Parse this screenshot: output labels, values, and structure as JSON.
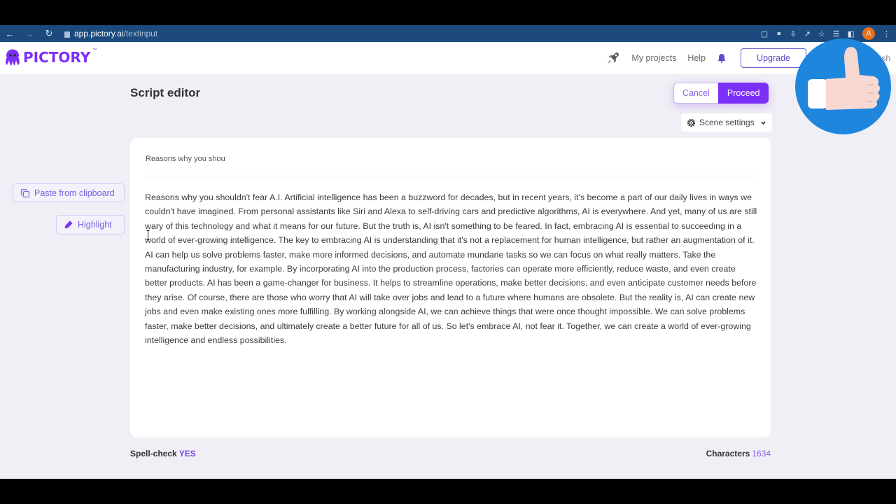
{
  "browser": {
    "url_host": "app.pictory.ai",
    "url_path": "/textinput",
    "profile_initial": "A",
    "icons": [
      "back-icon",
      "forward-icon",
      "reload-icon",
      "lock-icon",
      "clipboard-icon",
      "key-icon",
      "install-icon",
      "share-icon",
      "star-icon",
      "media-icon",
      "sidebar-icon",
      "menu-icon"
    ]
  },
  "header": {
    "logo_text": "PICTORY",
    "logo_tm": "™",
    "nav": {
      "my_projects": "My projects",
      "help": "Help",
      "upgrade": "Upgrade",
      "language_partial": "ish"
    }
  },
  "page": {
    "title": "Script editor",
    "cancel_label": "Cancel",
    "proceed_label": "Proceed",
    "scene_settings_label": "Scene settings"
  },
  "sidebar": {
    "paste_label": "Paste from clipboard",
    "highlight_label": "Highlight"
  },
  "editor": {
    "title_value": "Reasons why you shou",
    "body": "Reasons why you shouldn't fear A.I. Artificial intelligence has been a buzzword for decades, but in recent years, it's become a part of our daily lives in ways we couldn't have imagined. From personal assistants like Siri and Alexa to self-driving cars and predictive algorithms, AI is everywhere. And yet, many of us are still wary of this technology and what it means for our future. But the truth is, AI isn't something to be feared. In fact, embracing AI is essential to succeeding in a world of ever-growing intelligence. The key to embracing AI is understanding that it's not a replacement for human intelligence, but rather an augmentation of it. AI can help us solve problems faster, make more informed decisions, and automate mundane tasks so we can focus on what really matters. Take the manufacturing industry, for example. By incorporating AI into the production process, factories can operate more efficiently, reduce waste, and even create better products. AI has been a game-changer for business. It helps to streamline operations, make better decisions, and even anticipate customer needs before they arise. Of course, there are those who worry that AI will take over jobs and lead to a future where humans are obsolete. But the reality is, AI can create new jobs and even make existing ones more fulfilling. By working alongside AI, we can achieve things that were once thought impossible. We can solve problems faster, make better decisions, and ultimately create a better future for all of us. So let's embrace AI, not fear it. Together, we can create a world of ever-growing intelligence and endless possibilities."
  },
  "footer": {
    "spellcheck_label": "Spell-check",
    "spellcheck_value": "YES",
    "characters_label": "Characters",
    "characters_value": "1634"
  },
  "colors": {
    "brand": "#7b2ff7",
    "browser_bar": "#1c4a7e",
    "badge_blue": "#1f86dd"
  }
}
